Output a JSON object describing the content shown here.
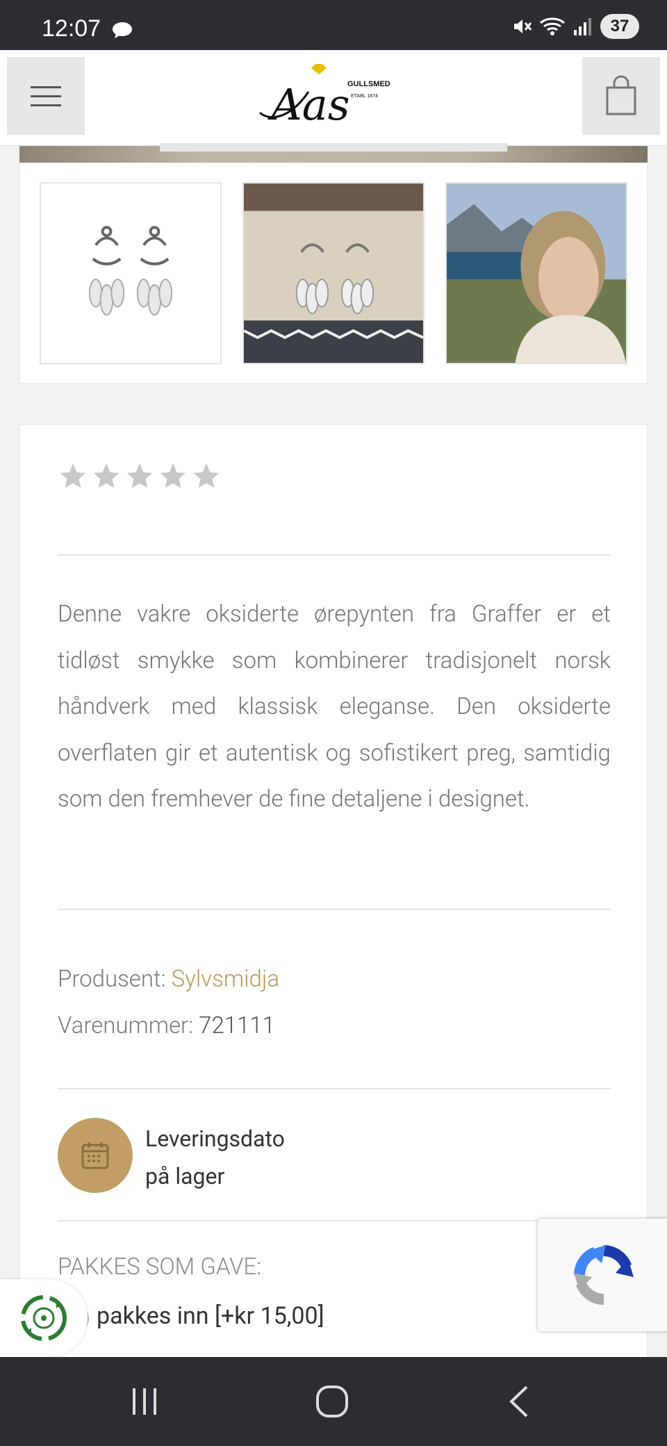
{
  "status_bar": {
    "time": "12:07",
    "battery": "37"
  },
  "header": {
    "brand_sub": "GULLSMED",
    "brand_main": "Aas",
    "brand_est": "ETABL 1874"
  },
  "product": {
    "description": "Denne vakre oksiderte ørepynten fra Graffer er et tidløst smykke som kombinerer tradisjonelt norsk håndverk med klassisk eleganse. Den oksiderte overflaten gir et autentisk og sofistikert preg, samtidig som den fremhever de fine detaljene i designet.",
    "rating_stars": 5,
    "producer_label": "Produsent:",
    "producer_value": "Sylvsmidja",
    "sku_label": "Varenummer:",
    "sku_value": "721111",
    "delivery_title": "Leveringsdato",
    "delivery_status": "på lager",
    "gift_title": "PAKKES SOM GAVE:",
    "gift_option": "pakkes inn [+kr 15,00]"
  },
  "colors": {
    "accent": "#b8985a",
    "icon_circle": "#c29e66",
    "star_gray": "#c8c8c8"
  }
}
